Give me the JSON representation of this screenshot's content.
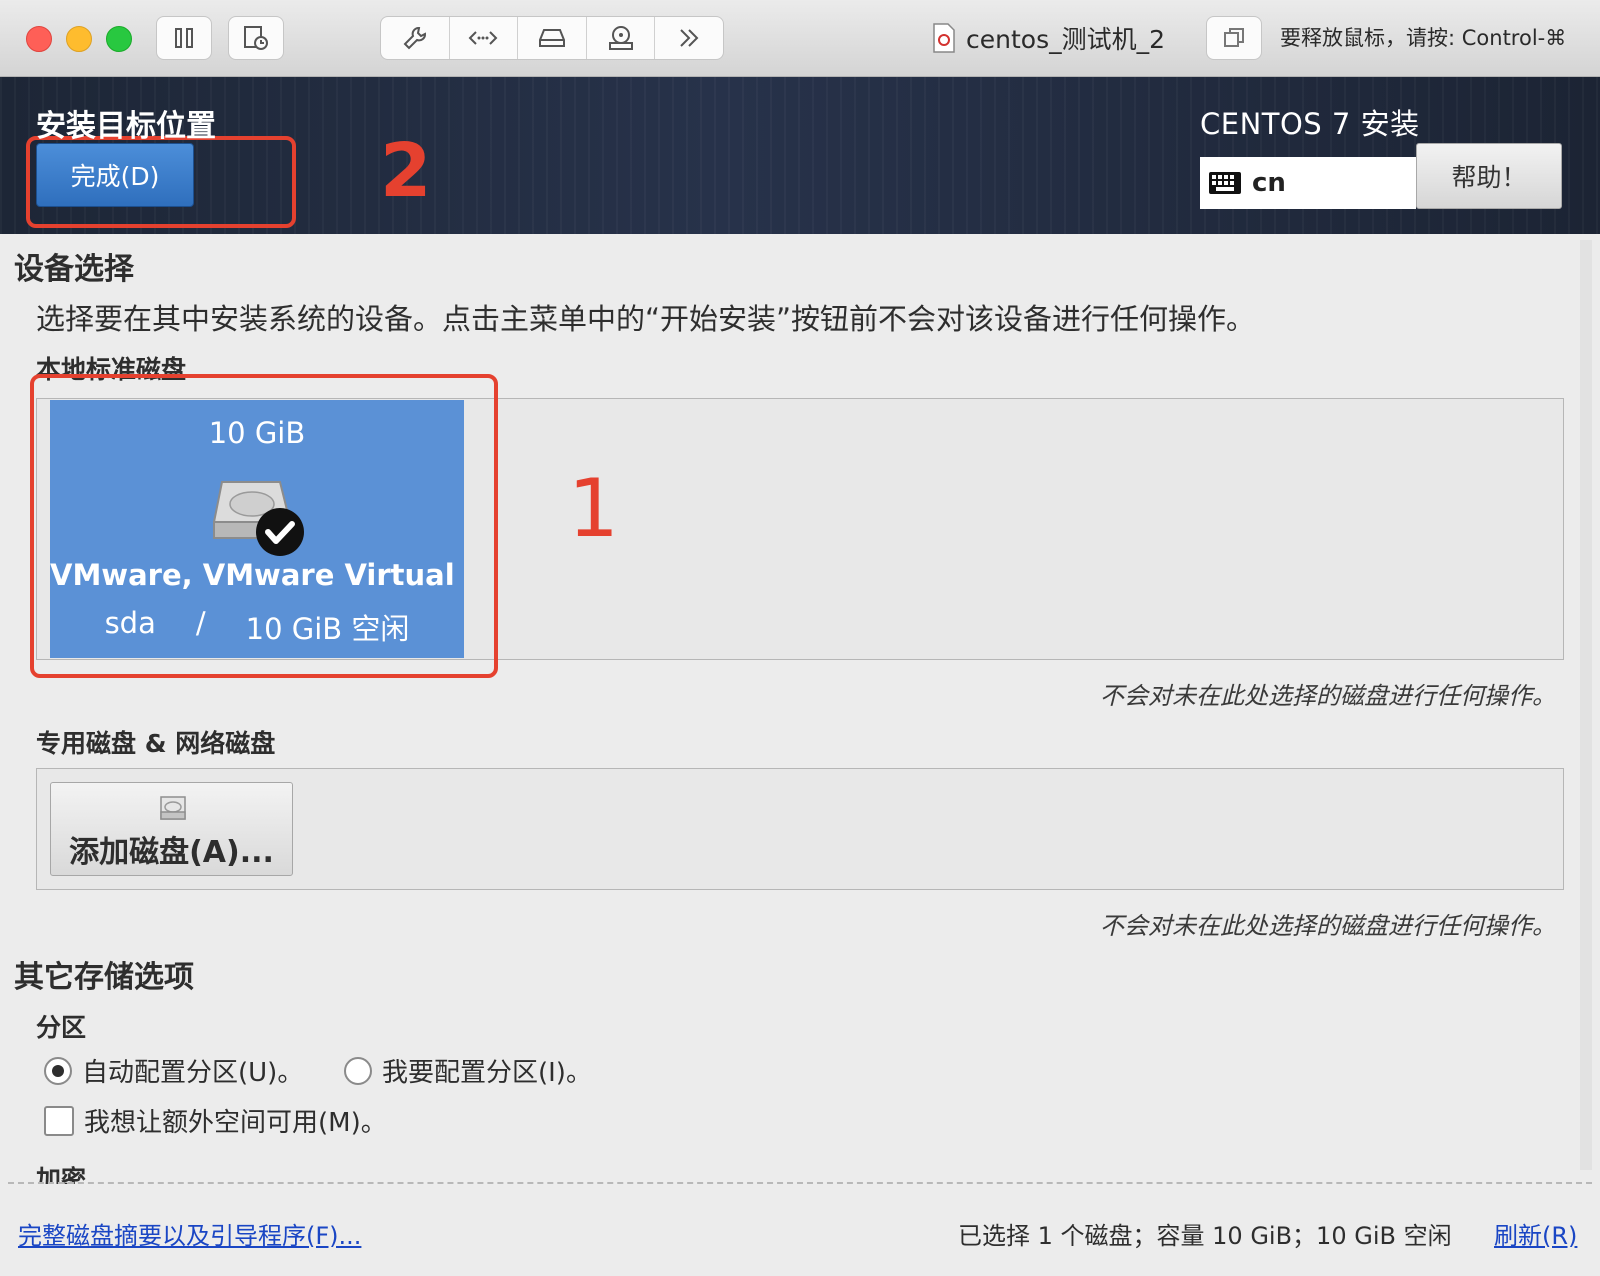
{
  "toolbar": {
    "vm_name": "centos_测试机_2",
    "release_hint": "要释放鼠标，请按: Control-⌘"
  },
  "header": {
    "title": "安装目标位置",
    "done_button": "完成(D)",
    "product": "CENTOS 7 安装",
    "keyboard_layout": "cn",
    "help_button": "帮助！"
  },
  "device_selection": {
    "title": "设备选择",
    "description": "选择要在其中安装系统的设备。点击主菜单中的“开始安装”按钮前不会对该设备进行任何操作。",
    "local_disks_label": "本地标准磁盘",
    "disk": {
      "size": "10 GiB",
      "name": "VMware, VMware Virtual S",
      "device": "sda",
      "separator": "/",
      "free": "10 GiB 空闲",
      "selected": true
    },
    "local_note": "不会对未在此处选择的磁盘进行任何操作。",
    "special_disks_label": "专用磁盘 & 网络磁盘",
    "add_disk_button": "添加磁盘(A)...",
    "special_note": "不会对未在此处选择的磁盘进行任何操作。"
  },
  "other_storage": {
    "title": "其它存储选项",
    "partition_label": "分区",
    "auto_partition": "自动配置分区(U)。",
    "auto_partition_selected": true,
    "manual_partition": "我要配置分区(I)。",
    "extra_space": "我想让额外空间可用(M)。",
    "encryption_label": "加密"
  },
  "footer": {
    "summary_link": "完整磁盘摘要以及引导程序(F)...",
    "status": "已选择 1 个磁盘；容量 10 GiB；10 GiB 空闲",
    "refresh_link": "刷新(R)"
  },
  "annotations": {
    "mark_1": "1",
    "mark_2": "2"
  },
  "colors": {
    "accent": "#2f6fbd",
    "disk_tile": "#5b91d6",
    "annotation": "#e5412f",
    "link": "#1a46c4"
  }
}
